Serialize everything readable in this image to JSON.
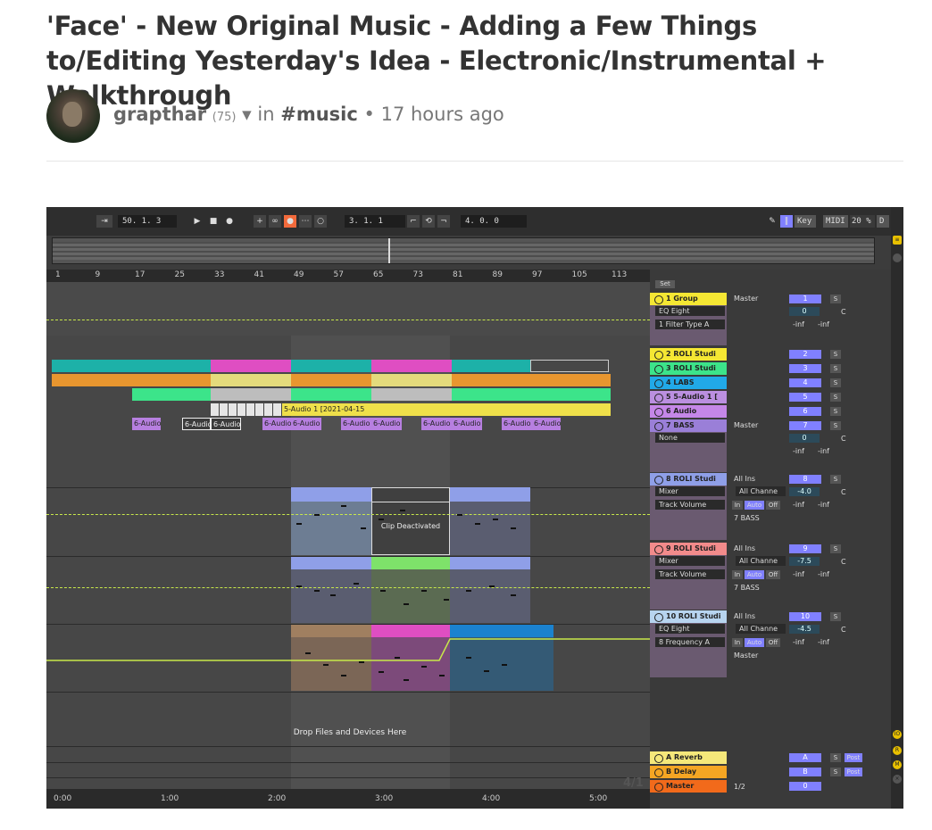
{
  "post": {
    "title": "'Face' - New Original Music - Adding a Few Things to/Editing Yesterday's Idea - Electronic/Instrumental + Walkthrough",
    "author": "grapthar",
    "reputation": "(75)",
    "in_label": "in",
    "community": "#music",
    "bullet": "•",
    "time": "17 hours ago"
  },
  "daw": {
    "tempo": "50. 1. 3",
    "position": "3. 1. 1",
    "loop_length": "4. 0. 0",
    "key_label": "Key",
    "midi_label": "MIDI",
    "cpu": "20 %",
    "d_label": "D",
    "set_label": "Set",
    "bar_ticks": [
      "1",
      "9",
      "17",
      "25",
      "33",
      "41",
      "49",
      "57",
      "65",
      "73",
      "81",
      "89",
      "97",
      "105",
      "113"
    ],
    "time_ticks": [
      "0:00",
      "1:00",
      "2:00",
      "3:00",
      "4:00",
      "5:00"
    ],
    "signature": "4/1",
    "clip_deactivated": "Clip Deactivated",
    "drop_hint": "Drop Files and Devices Here",
    "audio_clip_label": "5-Audio 1 [2021-04-15",
    "audio6_label": "6-Audio",
    "tracks": [
      {
        "name": "1 Group",
        "color": "#f5e733",
        "num": "1",
        "routing": "Master",
        "device": "EQ Eight",
        "param": "1 Filter Type A",
        "vol": "0",
        "pan": "C"
      },
      {
        "name": "2 ROLI Studi",
        "color": "#f5e733",
        "num": "2"
      },
      {
        "name": "3 ROLI Studi",
        "color": "#3ce48a",
        "num": "3"
      },
      {
        "name": "4 LABS",
        "color": "#21a9e8",
        "num": "4"
      },
      {
        "name": "5 5-Audio 1 [",
        "color": "#bb8fe0",
        "num": "5"
      },
      {
        "name": "6 Audio",
        "color": "#c587e8",
        "num": "6"
      },
      {
        "name": "7 BASS",
        "color": "#9a7fd8",
        "num": "7",
        "routing": "Master",
        "device": "None",
        "vol": "0",
        "pan": "C"
      },
      {
        "name": "8 ROLI Studi",
        "color": "#8f9fe8",
        "num": "8",
        "routing": "All Ins",
        "channel": "All Channe",
        "device": "Mixer",
        "param": "Track Volume",
        "vol": "-4.0",
        "pan": "C",
        "out": "7 BASS"
      },
      {
        "name": "9 ROLI Studi",
        "color": "#f28b8b",
        "num": "9",
        "routing": "All Ins",
        "channel": "All Channe",
        "device": "Mixer",
        "param": "Track Volume",
        "vol": "-7.5",
        "pan": "C",
        "out": "7 BASS"
      },
      {
        "name": "10 ROLI Studi",
        "color": "#b7d4ef",
        "num": "10",
        "routing": "All Ins",
        "channel": "All Channe",
        "device": "EQ Eight",
        "param": "8 Frequency A",
        "vol": "-4.5",
        "pan": "C",
        "out": "Master"
      }
    ],
    "returns": [
      {
        "name": "A Reverb",
        "color": "#f5e87a",
        "num": "A",
        "post": "Post"
      },
      {
        "name": "B Delay",
        "color": "#f5a623",
        "num": "B",
        "post": "Post"
      },
      {
        "name": "Master",
        "color": "#f26a1b",
        "num": "0",
        "routing": "1/2"
      }
    ],
    "inf": "-inf",
    "in": "In",
    "auto": "Auto",
    "off": "Off",
    "s": "S"
  }
}
